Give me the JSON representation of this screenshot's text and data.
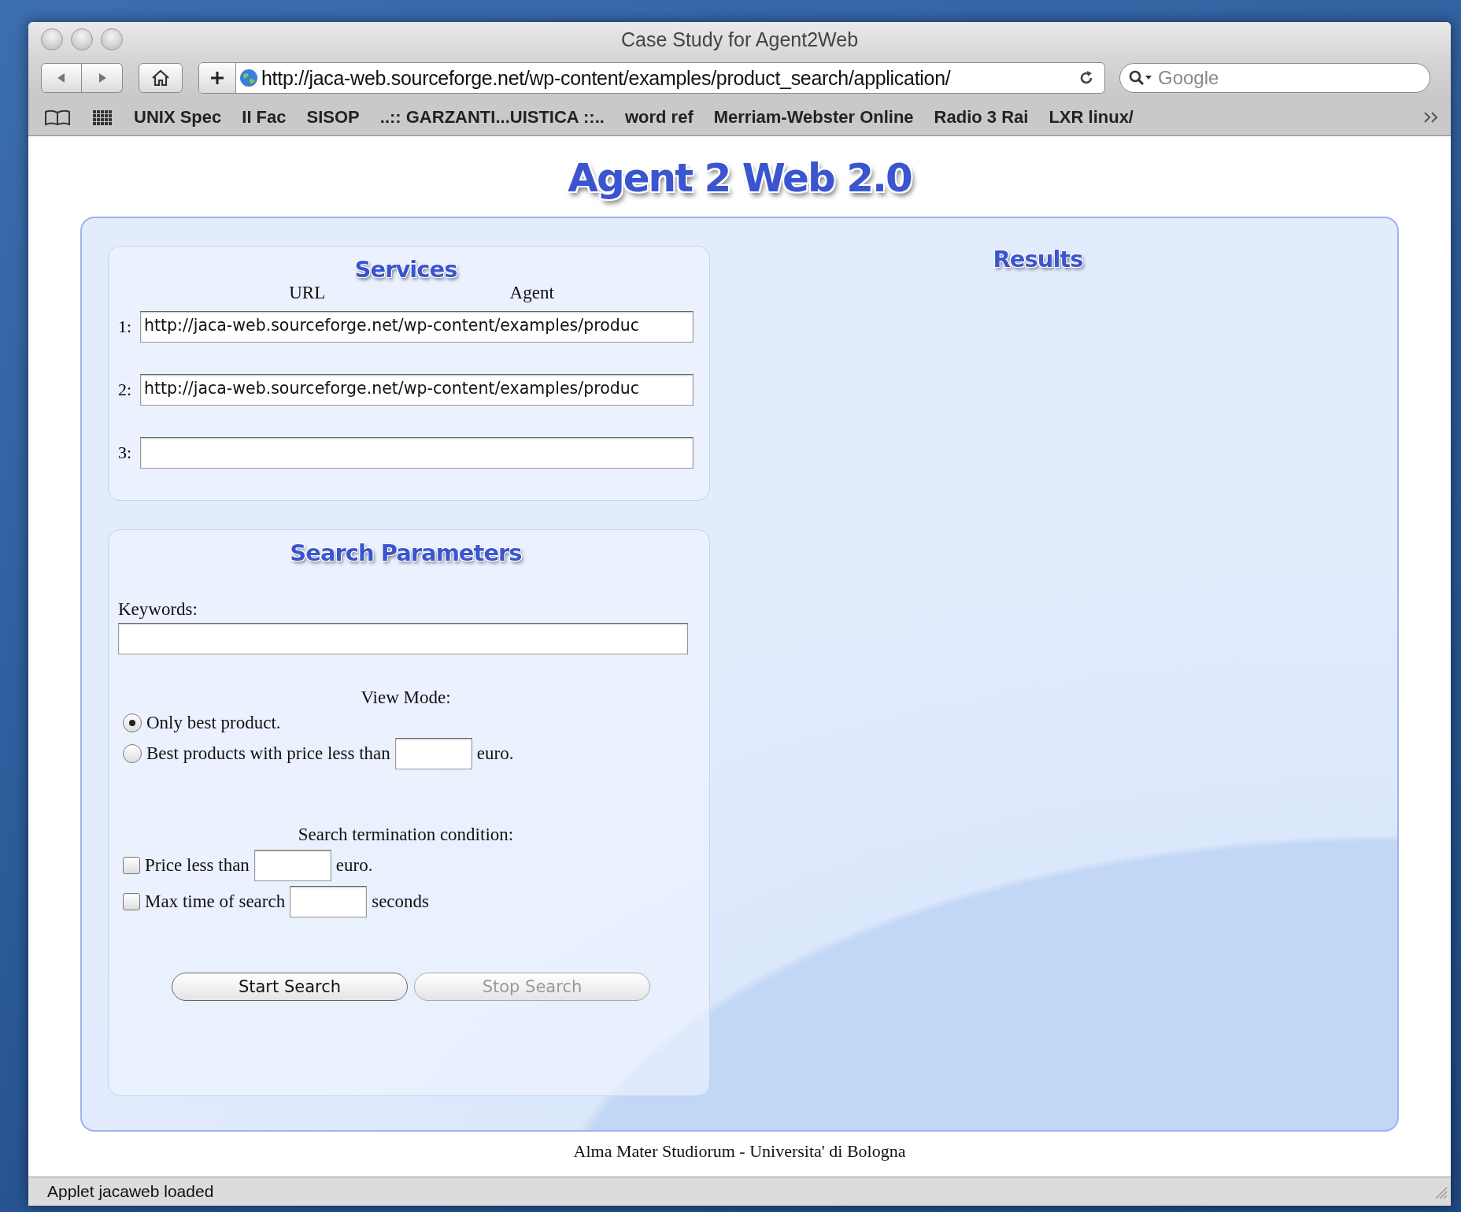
{
  "window": {
    "title": "Case Study for Agent2Web"
  },
  "toolbar": {
    "url": "http://jaca-web.sourceforge.net/wp-content/examples/product_search/application/",
    "search_placeholder": "Google"
  },
  "bookmarks": [
    "UNIX Spec",
    "II Fac",
    "SISOP",
    "..:: GARZANTI...UISTICA ::..",
    "word ref",
    "Merriam-Webster Online",
    "Radio 3 Rai",
    "LXR linux/"
  ],
  "page": {
    "title": "Agent 2 Web 2.0",
    "services": {
      "heading": "Services",
      "columns": [
        "URL",
        "Agent"
      ],
      "rows": [
        {
          "label": "1:",
          "value": "http://jaca-web.sourceforge.net/wp-content/examples/produc"
        },
        {
          "label": "2:",
          "value": "http://jaca-web.sourceforge.net/wp-content/examples/produc"
        },
        {
          "label": "3:"
        }
      ]
    },
    "search_parameters": {
      "heading": "Search Parameters",
      "keywords_label": "Keywords:",
      "view_mode_label": "View Mode:",
      "view_modes": [
        {
          "label": "Only best product.",
          "selected": true
        },
        {
          "label": "Best products with price less than",
          "suffix": "euro.",
          "selected": false
        }
      ],
      "termination_label": "Search termination condition:",
      "conditions": [
        {
          "label": "Price less than",
          "suffix": "euro.",
          "checked": false
        },
        {
          "label": "Max time of search",
          "suffix": "seconds",
          "checked": false
        }
      ],
      "buttons": [
        {
          "label": "Start Search",
          "disabled": false
        },
        {
          "label": "Stop Search",
          "disabled": true
        }
      ]
    },
    "results": {
      "heading": "Results"
    },
    "footer": "Alma Mater Studiorum - Universita' di Bologna"
  },
  "status_bar": "Applet jacaweb loaded"
}
